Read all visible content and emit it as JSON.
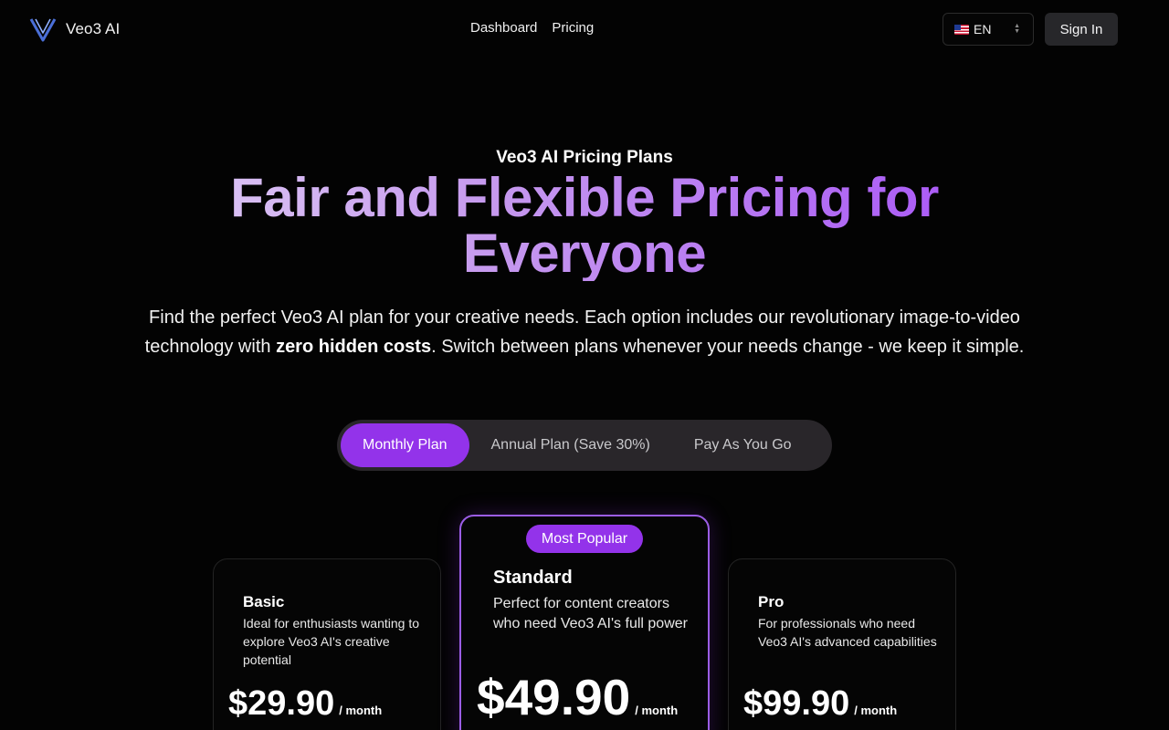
{
  "header": {
    "brand": "Veo3 AI",
    "nav": [
      {
        "label": "Dashboard"
      },
      {
        "label": "Pricing"
      }
    ],
    "language": {
      "flag": "us-flag-icon",
      "value": "EN"
    },
    "signin_label": "Sign In"
  },
  "hero": {
    "eyebrow": "Veo3 AI Pricing Plans",
    "title": "Fair and Flexible Pricing for Everyone",
    "description_before": "Find the perfect Veo3 AI plan for your creative needs. Each option includes our revolutionary image-to-video technology with ",
    "description_bold": "zero hidden costs",
    "description_after": ". Switch between plans whenever your needs change - we keep it simple."
  },
  "billing_toggle": {
    "options": [
      {
        "label": "Monthly Plan",
        "active": true
      },
      {
        "label": "Annual Plan (Save 30%)",
        "active": false
      },
      {
        "label": "Pay As You Go",
        "active": false
      }
    ]
  },
  "plans": [
    {
      "name": "Basic",
      "description": "Ideal for enthusiasts wanting to explore Veo3 AI's creative potential",
      "price": "$29.90",
      "period": "/ month"
    },
    {
      "name": "Standard",
      "badge": "Most Popular",
      "description": "Perfect for content creators who need Veo3 AI's full power",
      "price": "$49.90",
      "period": "/ month"
    },
    {
      "name": "Pro",
      "description": "For professionals who need Veo3 AI's advanced capabilities",
      "price": "$99.90",
      "period": "/ month"
    }
  ],
  "colors": {
    "background": "#030303",
    "accent": "#9333ea",
    "toggle_track": "#29262a",
    "signin_bg": "#27272a"
  }
}
